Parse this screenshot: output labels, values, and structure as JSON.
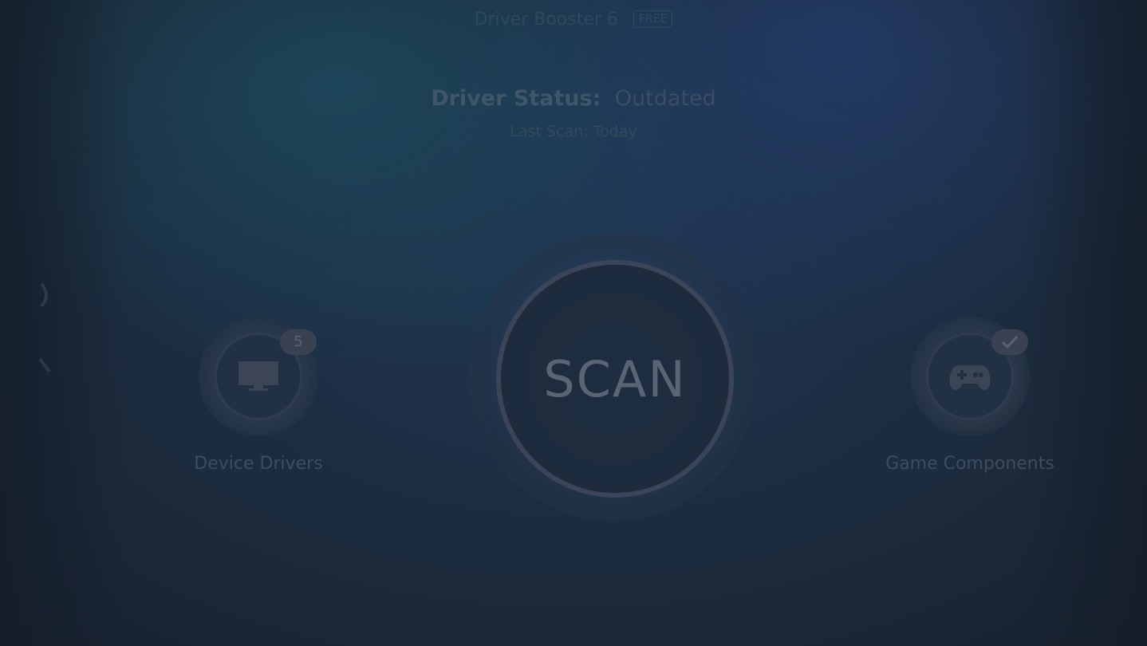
{
  "header": {
    "app_title": "Driver Booster 6",
    "edition_badge": "FREE"
  },
  "status": {
    "label": "Driver Status:",
    "value": "Outdated",
    "last_scan": "Last Scan: Today"
  },
  "scan_button": {
    "label": "SCAN"
  },
  "features": {
    "device_drivers": {
      "label": "Device Drivers",
      "badge": "5",
      "icon": "monitor-icon"
    },
    "game_components": {
      "label": "Game Components",
      "badge_icon": "check-icon",
      "icon": "gamepad-icon"
    }
  },
  "colors": {
    "background": "#1b2838",
    "scan_ring": "#3b4459",
    "badge": "#3a4252"
  }
}
